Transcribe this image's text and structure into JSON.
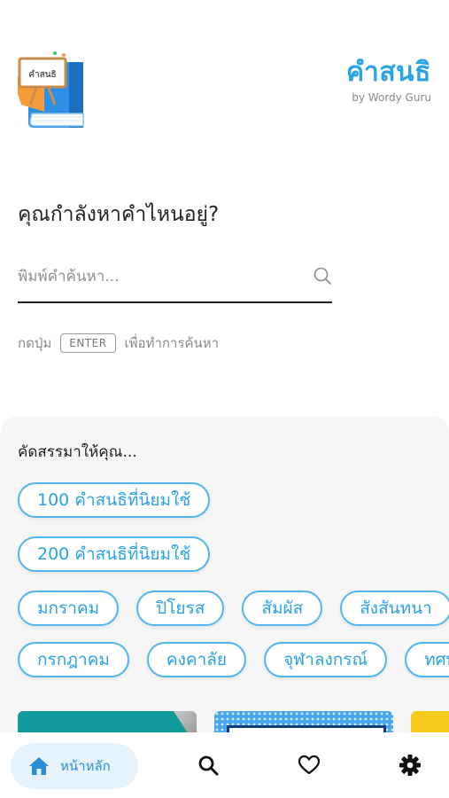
{
  "app": {
    "title": "คำสนธิ",
    "subtitle": "by Wordy Guru",
    "logo_text": "คำสนธิ"
  },
  "search": {
    "question": "คุณกำลังหาคำไหนอยู่?",
    "placeholder": "พิมพ์คำค้นหา...",
    "value": "",
    "hint_before": "กดปุ่ม",
    "hint_key": "ENTER",
    "hint_after": "เพื่อทำการค้นหา"
  },
  "recommend": {
    "title": "คัดสรรมาให้คุณ...",
    "row1": [
      "100 คำสนธิที่นิยมใช้"
    ],
    "row2": [
      "200 คำสนธิที่นิยมใช้"
    ],
    "row3": [
      "มกราคม",
      "ปิโยรส",
      "สัมผัส",
      "สังสันทนา"
    ],
    "row4": [
      "กรกฎาคม",
      "คงคาลัย",
      "จุฬาลงกรณ์",
      "ทศพร"
    ]
  },
  "nav": {
    "home_label": "หน้าหลัก",
    "icons": [
      "home-icon",
      "search-icon",
      "heart-icon",
      "gear-icon"
    ],
    "active_color": "#2a8fd6"
  },
  "colors": {
    "accent": "#2aa2e6",
    "chip_border": "#4fb6ee"
  }
}
